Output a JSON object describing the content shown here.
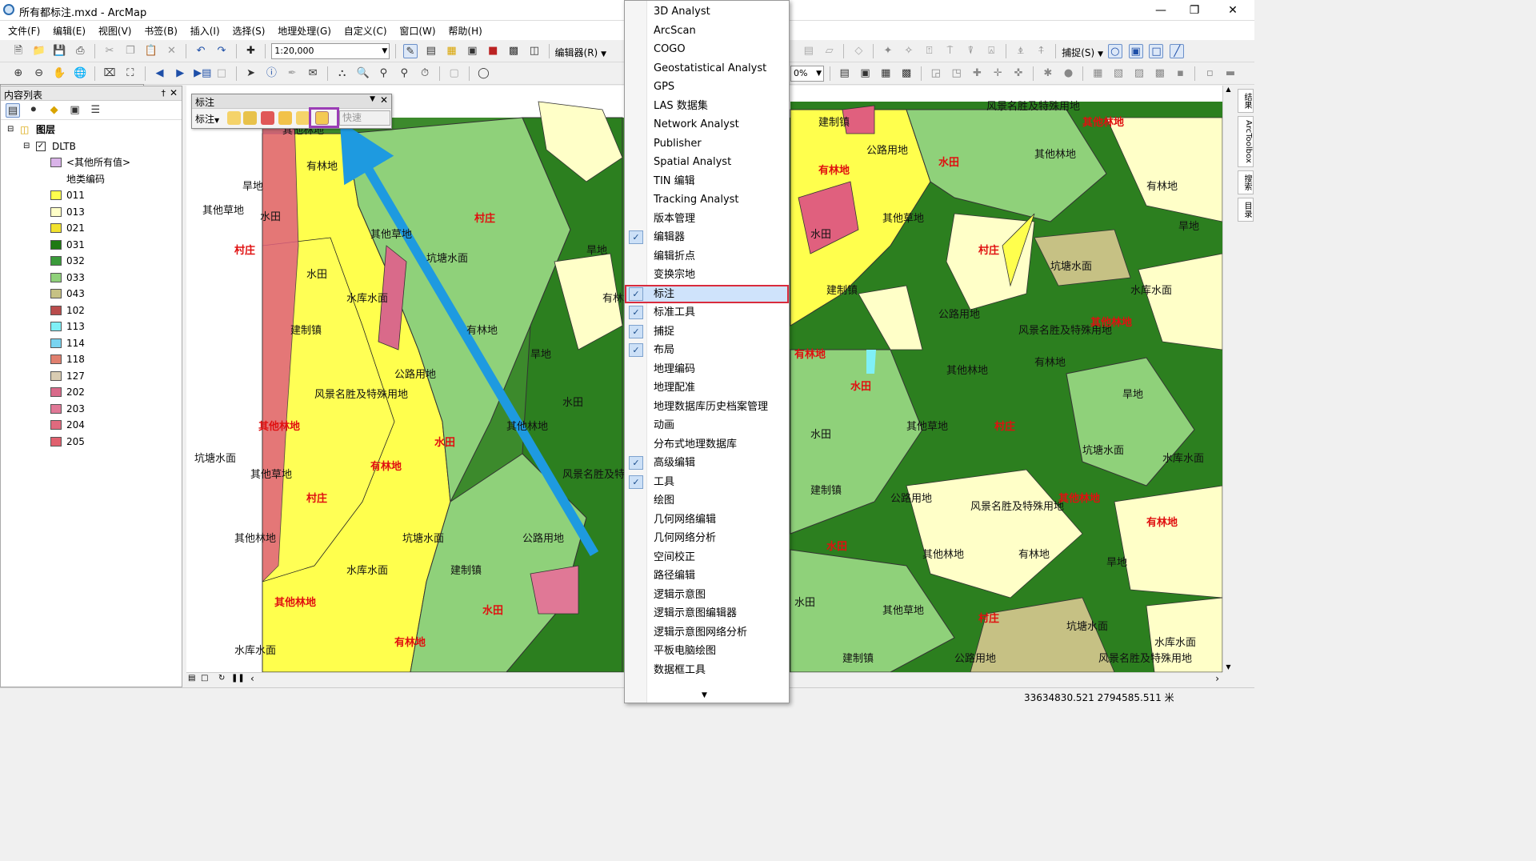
{
  "window": {
    "title": "所有都标注.mxd - ArcMap",
    "minimize": "—",
    "restore": "❐",
    "close": "✕"
  },
  "menubar": [
    "文件(F)",
    "编辑(E)",
    "视图(V)",
    "书签(B)",
    "插入(I)",
    "选择(S)",
    "地理处理(G)",
    "自定义(C)",
    "窗口(W)",
    "帮助(H)"
  ],
  "toolbar": {
    "scale": "1:20,000",
    "editor_label": "编辑器(R)",
    "snapping_label": "捕捉(S)",
    "zoom_percent": "0%"
  },
  "toc": {
    "title": "内容列表",
    "pin": "†",
    "close": "✕",
    "root": "图层",
    "layer": "DLTB",
    "other_values": "<其他所有值>",
    "field": "地类编码",
    "legend": [
      {
        "code": "011",
        "color": "#ffff4d"
      },
      {
        "code": "013",
        "color": "#ffffc8"
      },
      {
        "code": "021",
        "color": "#f2e22e"
      },
      {
        "code": "031",
        "color": "#1f7a12"
      },
      {
        "code": "032",
        "color": "#3a9a3a"
      },
      {
        "code": "033",
        "color": "#8fd17a"
      },
      {
        "code": "043",
        "color": "#c6c184"
      },
      {
        "code": "102",
        "color": "#b94c4c"
      },
      {
        "code": "113",
        "color": "#7ff0f7"
      },
      {
        "code": "114",
        "color": "#79d4f0"
      },
      {
        "code": "118",
        "color": "#e07f6e"
      },
      {
        "code": "127",
        "color": "#d9ccb2"
      },
      {
        "code": "202",
        "color": "#d96a8a"
      },
      {
        "code": "203",
        "color": "#e07896"
      },
      {
        "code": "204",
        "color": "#e06a7e"
      },
      {
        "code": "205",
        "color": "#e0606e"
      }
    ]
  },
  "label_toolbar": {
    "title": "标注",
    "menu": "标注",
    "quick": "快速"
  },
  "menu_items": [
    {
      "label": "3D Analyst",
      "checked": false
    },
    {
      "label": "ArcScan",
      "checked": false
    },
    {
      "label": "COGO",
      "checked": false
    },
    {
      "label": "Geostatistical Analyst",
      "checked": false
    },
    {
      "label": "GPS",
      "checked": false
    },
    {
      "label": "LAS 数据集",
      "checked": false
    },
    {
      "label": "Network Analyst",
      "checked": false
    },
    {
      "label": "Publisher",
      "checked": false
    },
    {
      "label": "Spatial Analyst",
      "checked": false
    },
    {
      "label": "TIN 编辑",
      "checked": false
    },
    {
      "label": "Tracking Analyst",
      "checked": false
    },
    {
      "label": "版本管理",
      "checked": false
    },
    {
      "label": "编辑器",
      "checked": true
    },
    {
      "label": "编辑折点",
      "checked": false
    },
    {
      "label": "变换宗地",
      "checked": false
    },
    {
      "label": "标注",
      "checked": true,
      "highlighted": true
    },
    {
      "label": "标准工具",
      "checked": true
    },
    {
      "label": "捕捉",
      "checked": true
    },
    {
      "label": "布局",
      "checked": true
    },
    {
      "label": "地理编码",
      "checked": false
    },
    {
      "label": "地理配准",
      "checked": false
    },
    {
      "label": "地理数据库历史档案管理",
      "checked": false
    },
    {
      "label": "动画",
      "checked": false
    },
    {
      "label": "分布式地理数据库",
      "checked": false
    },
    {
      "label": "高级编辑",
      "checked": true
    },
    {
      "label": "工具",
      "checked": true
    },
    {
      "label": "绘图",
      "checked": false
    },
    {
      "label": "几何网络编辑",
      "checked": false
    },
    {
      "label": "几何网络分析",
      "checked": false
    },
    {
      "label": "空间校正",
      "checked": false
    },
    {
      "label": "路径编辑",
      "checked": false
    },
    {
      "label": "逻辑示意图",
      "checked": false
    },
    {
      "label": "逻辑示意图编辑器",
      "checked": false
    },
    {
      "label": "逻辑示意图网络分析",
      "checked": false
    },
    {
      "label": "平板电脑绘图",
      "checked": false
    },
    {
      "label": "数据框工具",
      "checked": false
    }
  ],
  "dock": [
    "结果",
    "ArcToolbox",
    "搜索",
    "目录"
  ],
  "status": {
    "coords": "33634830.521   2794585.511 米"
  },
  "map_labels": [
    {
      "t": "其他林地",
      "c": "black"
    },
    {
      "t": "有林地",
      "c": "black"
    },
    {
      "t": "旱地",
      "c": "black"
    },
    {
      "t": "水田",
      "c": "black"
    },
    {
      "t": "其他草地",
      "c": "black"
    },
    {
      "t": "村庄",
      "c": "red"
    },
    {
      "t": "坑塘水面",
      "c": "black"
    },
    {
      "t": "水库水面",
      "c": "black"
    },
    {
      "t": "建制镇",
      "c": "black"
    },
    {
      "t": "公路用地",
      "c": "black"
    },
    {
      "t": "风景名胜及特殊用地",
      "c": "black"
    },
    {
      "t": "其他林地",
      "c": "red"
    },
    {
      "t": "有林地",
      "c": "red"
    },
    {
      "t": "水田",
      "c": "red"
    }
  ]
}
